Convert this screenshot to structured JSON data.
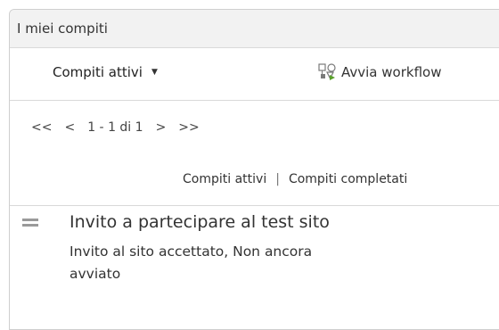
{
  "dashlet": {
    "title": "I miei compiti"
  },
  "toolbar": {
    "filter_label": "Compiti attivi",
    "filter_caret": "▼",
    "workflow_label": "Avvia workflow"
  },
  "pager": {
    "first": "<<",
    "prev": "<",
    "range": "1 - 1 di 1",
    "next": ">",
    "last": ">>"
  },
  "links": {
    "active": "Compiti attivi",
    "separator": "|",
    "completed": "Compiti completati"
  },
  "tasks": [
    {
      "title": "Invito a partecipare al test sito",
      "status": "Invito al sito accettato, Non ancora avviato"
    }
  ],
  "colors": {
    "header_bg": "#f2f2f2",
    "border": "#d9d9d9",
    "text": "#333333"
  },
  "icons": {
    "workflow": "workflow-icon",
    "task": "drag-handle-icon"
  }
}
